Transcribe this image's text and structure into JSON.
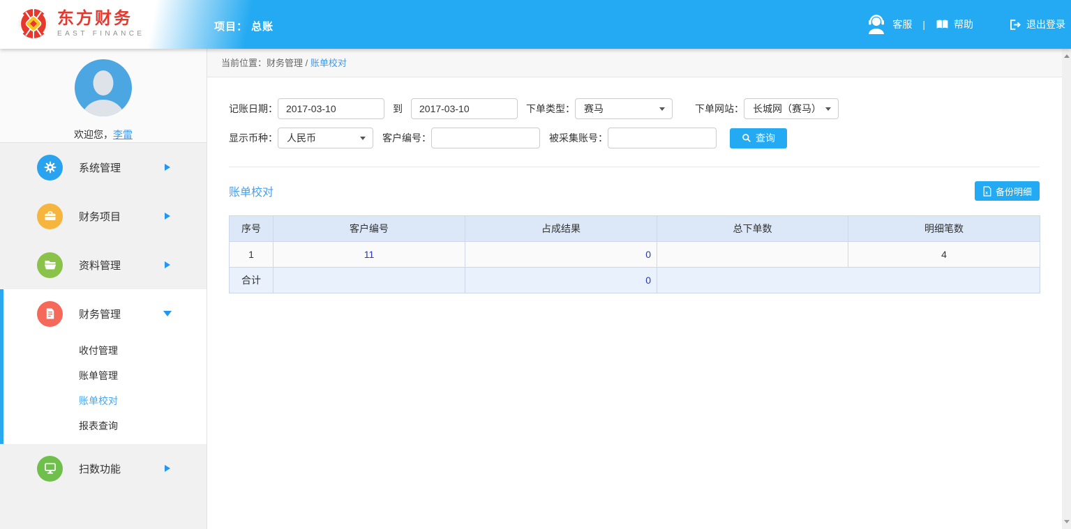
{
  "colors": {
    "accent": "#23aaf2",
    "link": "#3d9af0",
    "table_link": "#2537be",
    "brand_red": "#e6382c",
    "menu_icon_system": "#29a3ef",
    "menu_icon_project": "#f5b53e",
    "menu_icon_data": "#8bc34a",
    "menu_icon_finance": "#f4695a",
    "menu_icon_scan": "#6fbf4c",
    "table_header_bg": "#dce8f8",
    "total_row_bg": "#e9f1fc"
  },
  "brand": {
    "name_cn": "东方财务",
    "name_en": "EAST FINANCE"
  },
  "header": {
    "project_label": "项目： 总账",
    "actions": {
      "customer_service": "客服",
      "separator": "|",
      "help": "帮助",
      "logout": "退出登录"
    }
  },
  "sidebar": {
    "welcome_prefix": "欢迎您，",
    "username": "李雷",
    "menu": [
      {
        "label": "系统管理",
        "icon": "gear-icon",
        "state": "collapsed"
      },
      {
        "label": "财务项目",
        "icon": "briefcase-icon",
        "state": "collapsed"
      },
      {
        "label": "资料管理",
        "icon": "folder-icon",
        "state": "collapsed"
      },
      {
        "label": "财务管理",
        "icon": "document-icon",
        "state": "expanded",
        "children": [
          {
            "label": "收付管理",
            "active": false
          },
          {
            "label": "账单管理",
            "active": false
          },
          {
            "label": "账单校对",
            "active": true
          },
          {
            "label": "报表查询",
            "active": false
          }
        ]
      },
      {
        "label": "扫数功能",
        "icon": "monitor-icon",
        "state": "collapsed"
      }
    ]
  },
  "breadcrumb": {
    "prefix": "当前位置：",
    "parent": "财务管理",
    "separator": " / ",
    "current": "账单校对"
  },
  "filters": {
    "booking_date_label": "记账日期：",
    "date_from": "2017-03-10",
    "to_label": "到",
    "date_to": "2017-03-10",
    "order_type_label": "下单类型：",
    "order_type_value": "赛马",
    "order_site_label": "下单网站：",
    "order_site_value": "长城网（赛马）",
    "currency_label": "显示币种：",
    "currency_value": "人民币",
    "customer_id_label": "客户编号：",
    "customer_id_value": "",
    "collected_account_label": "被采集账号：",
    "collected_account_value": "",
    "search_button": "查询"
  },
  "section": {
    "title": "账单校对",
    "backup_button": "备份明细"
  },
  "table": {
    "columns": [
      "序号",
      "客户编号",
      "占成结果",
      "总下单数",
      "明细笔数"
    ],
    "rows": [
      {
        "seq": "1",
        "customer_id": "11",
        "share_result": "0",
        "total_orders": "",
        "detail_count": "4"
      }
    ],
    "total_row": {
      "seq": "合计",
      "customer_id": "",
      "share_result": "0",
      "merged": ""
    }
  }
}
